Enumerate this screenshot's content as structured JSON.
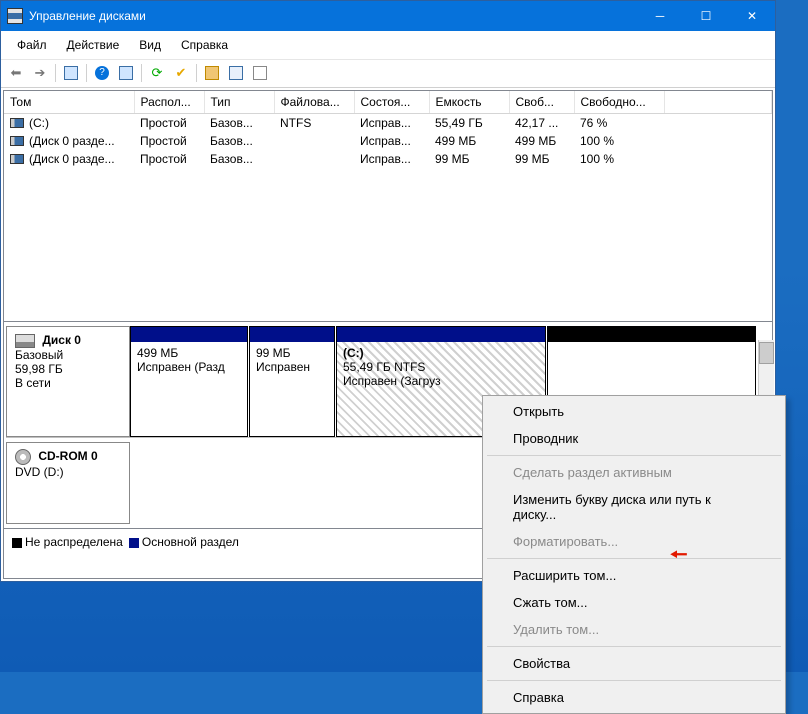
{
  "window": {
    "title": "Управление дисками"
  },
  "menu": {
    "file": "Файл",
    "action": "Действие",
    "view": "Вид",
    "help": "Справка"
  },
  "columns": {
    "volume": "Том",
    "layout": "Распол...",
    "type": "Тип",
    "fs": "Файлова...",
    "status": "Состоя...",
    "capacity": "Емкость",
    "free": "Своб...",
    "freepct": "Свободно..."
  },
  "rows": [
    {
      "volume": "(C:)",
      "layout": "Простой",
      "type": "Базов...",
      "fs": "NTFS",
      "status": "Исправ...",
      "capacity": "55,49 ГБ",
      "free": "42,17 ...",
      "freepct": "76 %"
    },
    {
      "volume": "(Диск 0 разде...",
      "layout": "Простой",
      "type": "Базов...",
      "fs": "",
      "status": "Исправ...",
      "capacity": "499 МБ",
      "free": "499 МБ",
      "freepct": "100 %"
    },
    {
      "volume": "(Диск 0 разде...",
      "layout": "Простой",
      "type": "Базов...",
      "fs": "",
      "status": "Исправ...",
      "capacity": "99 МБ",
      "free": "99 МБ",
      "freepct": "100 %"
    }
  ],
  "disks": {
    "d0": {
      "name": "Диск 0",
      "type": "Базовый",
      "size": "59,98 ГБ",
      "status": "В сети",
      "parts": [
        {
          "title": "",
          "line1": "499 МБ",
          "line2": "Исправен (Разд"
        },
        {
          "title": "",
          "line1": "99 МБ",
          "line2": "Исправен"
        },
        {
          "title": "(C:)",
          "line1": "55,49 ГБ NTFS",
          "line2": "Исправен (Загруз"
        },
        {
          "title": "",
          "line1": "",
          "line2": ""
        }
      ]
    },
    "cd": {
      "name": "CD-ROM 0",
      "sub": "DVD (D:)"
    }
  },
  "legend": {
    "unallocated": "Не распределена",
    "primary": "Основной раздел"
  },
  "context": {
    "open": "Открыть",
    "explorer": "Проводник",
    "active": "Сделать раздел активным",
    "letter": "Изменить букву диска или путь к диску...",
    "format": "Форматировать...",
    "extend": "Расширить том...",
    "shrink": "Сжать том...",
    "delete": "Удалить том...",
    "props": "Свойства",
    "help": "Справка"
  }
}
